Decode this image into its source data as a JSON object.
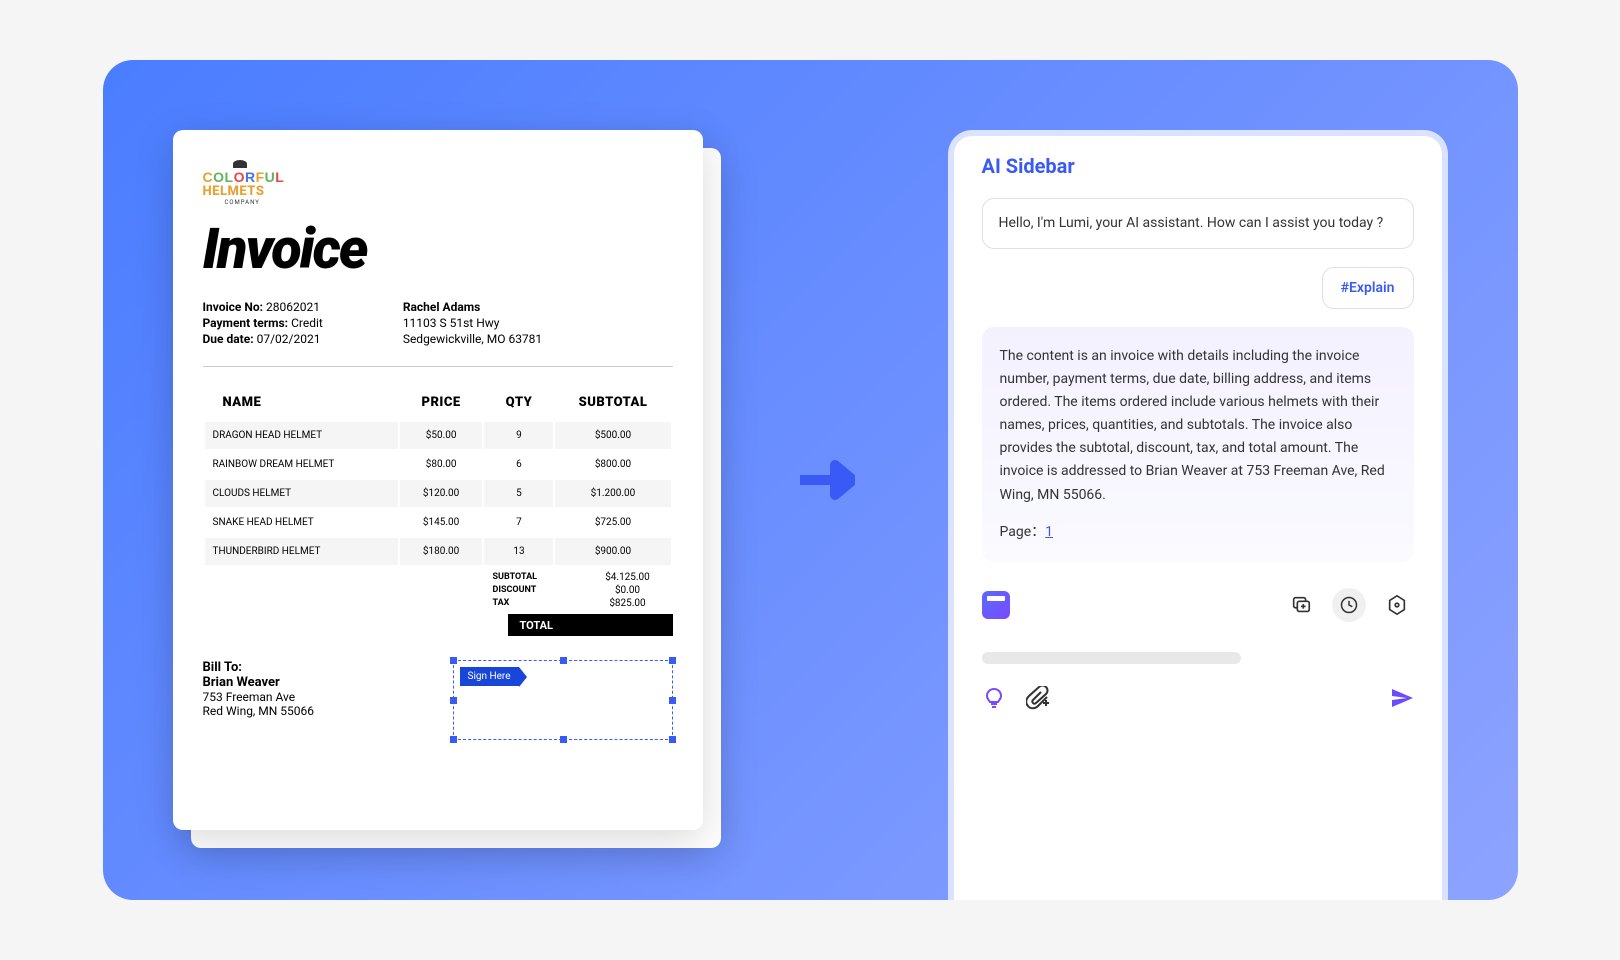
{
  "invoice": {
    "logo": {
      "line1": "COLORFUL",
      "line2": "HELMETS",
      "sub": "COMPANY"
    },
    "title": "Invoice",
    "meta": {
      "invoice_no_label": "Invoice No:",
      "invoice_no": "28062021",
      "payment_terms_label": "Payment terms:",
      "payment_terms": "Credit",
      "due_date_label": "Due date:",
      "due_date": "07/02/2021",
      "bill_name": "Rachel Adams",
      "bill_addr1": "11103 S 51st Hwy",
      "bill_addr2": "Sedgewickville, MO 63781"
    },
    "table": {
      "headers": [
        "NAME",
        "PRICE",
        "QTY",
        "SUBTOTAL"
      ],
      "rows": [
        {
          "name": "DRAGON HEAD HELMET",
          "price": "$50.00",
          "qty": "9",
          "sub": "$500.00"
        },
        {
          "name": "RAINBOW DREAM HELMET",
          "price": "$80.00",
          "qty": "6",
          "sub": "$800.00"
        },
        {
          "name": "CLOUDS HELMET",
          "price": "$120.00",
          "qty": "5",
          "sub": "$1.200.00"
        },
        {
          "name": "SNAKE HEAD HELMET",
          "price": "$145.00",
          "qty": "7",
          "sub": "$725.00"
        },
        {
          "name": "THUNDERBIRD HELMET",
          "price": "$180.00",
          "qty": "13",
          "sub": "$900.00"
        }
      ]
    },
    "totals": {
      "subtotal_label": "SUBTOTAL",
      "subtotal": "$4.125.00",
      "discount_label": "DISCOUNT",
      "discount": "$0.00",
      "tax_label": "TAX",
      "tax": "$825.00",
      "total_label": "TOTAL"
    },
    "bill_to": {
      "title": "Bill To:",
      "name": "Brian Weaver",
      "addr1": "753 Freeman Ave",
      "addr2": "Red Wing, MN 55066"
    },
    "sign_here": "Sign Here"
  },
  "sidebar": {
    "title": "AI Sidebar",
    "greeting": "Hello, I'm Lumi, your AI assistant. How can I assist you today ?",
    "hash": "#Explain",
    "response": "The content is an invoice with details including the invoice number, payment terms, due date, billing address, and items ordered. The items ordered include various helmets with their names, prices, quantities, and subtotals. The invoice also provides the subtotal, discount, tax, and total amount. The invoice is addressed to Brian Weaver at 753 Freeman Ave, Red Wing, MN 55066.",
    "page_label": "Page：",
    "page_num": "1"
  }
}
